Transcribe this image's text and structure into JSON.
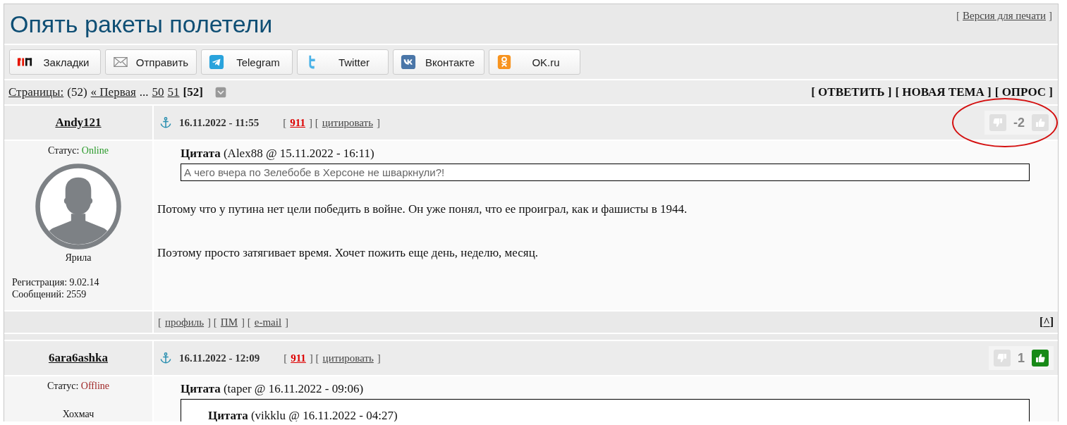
{
  "topic": {
    "title": "Опять ракеты полетели",
    "print_link": [
      {
        "kind": "punct",
        "text": "["
      },
      {
        "kind": "link",
        "text": "Версия для печати"
      },
      {
        "kind": "punct",
        "text": "]"
      }
    ]
  },
  "share_buttons": [
    {
      "kind": "yandex",
      "label": "Закладки"
    },
    {
      "kind": "mail",
      "label": "Отправить"
    },
    {
      "kind": "telegram",
      "label": "Telegram"
    },
    {
      "kind": "twitter",
      "label": "Twitter"
    },
    {
      "kind": "vk",
      "label": "Вконтакте"
    },
    {
      "kind": "ok",
      "label": "OK.ru"
    }
  ],
  "pagination": {
    "label": "Страницы:",
    "count": "(52)",
    "first": "« Первая",
    "ellipsis": "...",
    "pages": [
      {
        "label": "50",
        "selected": false
      },
      {
        "label": "51",
        "selected": false
      },
      {
        "label": "[52]",
        "selected": true
      }
    ]
  },
  "actions": [
    "[ ОТВЕТИТЬ ]",
    "[ НОВАЯ ТЕМА ]",
    "[ ОПРОС ]"
  ],
  "posts": [
    {
      "author": "Andy121",
      "status_label": "Статус:",
      "status": "Online",
      "online": true,
      "avatar": true,
      "rank": "Ярила",
      "stats": [
        "Регистрация: 9.02.14",
        "Сообщений: 2559"
      ],
      "date": "16.11.2022 - 11:55",
      "meta": [
        {
          "kind": "punct",
          "text": "["
        },
        {
          "kind": "hot",
          "text": "911"
        },
        {
          "kind": "punct",
          "text": "] ["
        },
        {
          "kind": "link",
          "text": "цитировать"
        },
        {
          "kind": "punct",
          "text": "]"
        }
      ],
      "votes": {
        "score": "-2",
        "dislike_active": false,
        "like_active": false
      },
      "circled": true,
      "quotes": [
        {
          "title": "**Цитата** (Alex88 @ 15.11.2022 - 16:11)",
          "text": "А чего вчера по Зелебобе в Херсоне не шваркнули?!"
        }
      ],
      "paragraphs": [
        "Потому что у путина нет цели победить в войне. Он уже понял, что ее проиграл, как и фашисты в 1944.",
        "Поэтому просто затягивает время. Хочет пожить еще день, неделю, месяц."
      ],
      "footer": [
        {
          "kind": "punct",
          "text": "["
        },
        {
          "kind": "link",
          "text": "профиль"
        },
        {
          "kind": "punct",
          "text": "] ["
        },
        {
          "kind": "link",
          "text": "ПМ"
        },
        {
          "kind": "punct",
          "text": "] ["
        },
        {
          "kind": "link",
          "text": "e-mail"
        },
        {
          "kind": "punct",
          "text": "]"
        }
      ],
      "top_link": [
        {
          "kind": "punct",
          "text": "["
        },
        {
          "kind": "link",
          "text": "^"
        },
        {
          "kind": "punct",
          "text": "]"
        }
      ]
    },
    {
      "author": "6ara6ashka",
      "status_label": "Статус:",
      "status": "Offline",
      "online": false,
      "avatar": false,
      "rank": "Хохмач",
      "date": "16.11.2022 - 12:09",
      "meta": [
        {
          "kind": "punct",
          "text": "["
        },
        {
          "kind": "hot",
          "text": "911"
        },
        {
          "kind": "punct",
          "text": "] ["
        },
        {
          "kind": "link",
          "text": "цитировать"
        },
        {
          "kind": "punct",
          "text": "]"
        }
      ],
      "votes": {
        "score": "1",
        "dislike_active": false,
        "like_active": true
      },
      "circled": false,
      "quotes": [
        {
          "title": "**Цитата** (taper @ 16.11.2022 - 09:06)",
          "children": [
            {
              "title": "**Цитата** (vikklu @ 16.11.2022 - 04:27)"
            }
          ]
        }
      ]
    }
  ]
}
